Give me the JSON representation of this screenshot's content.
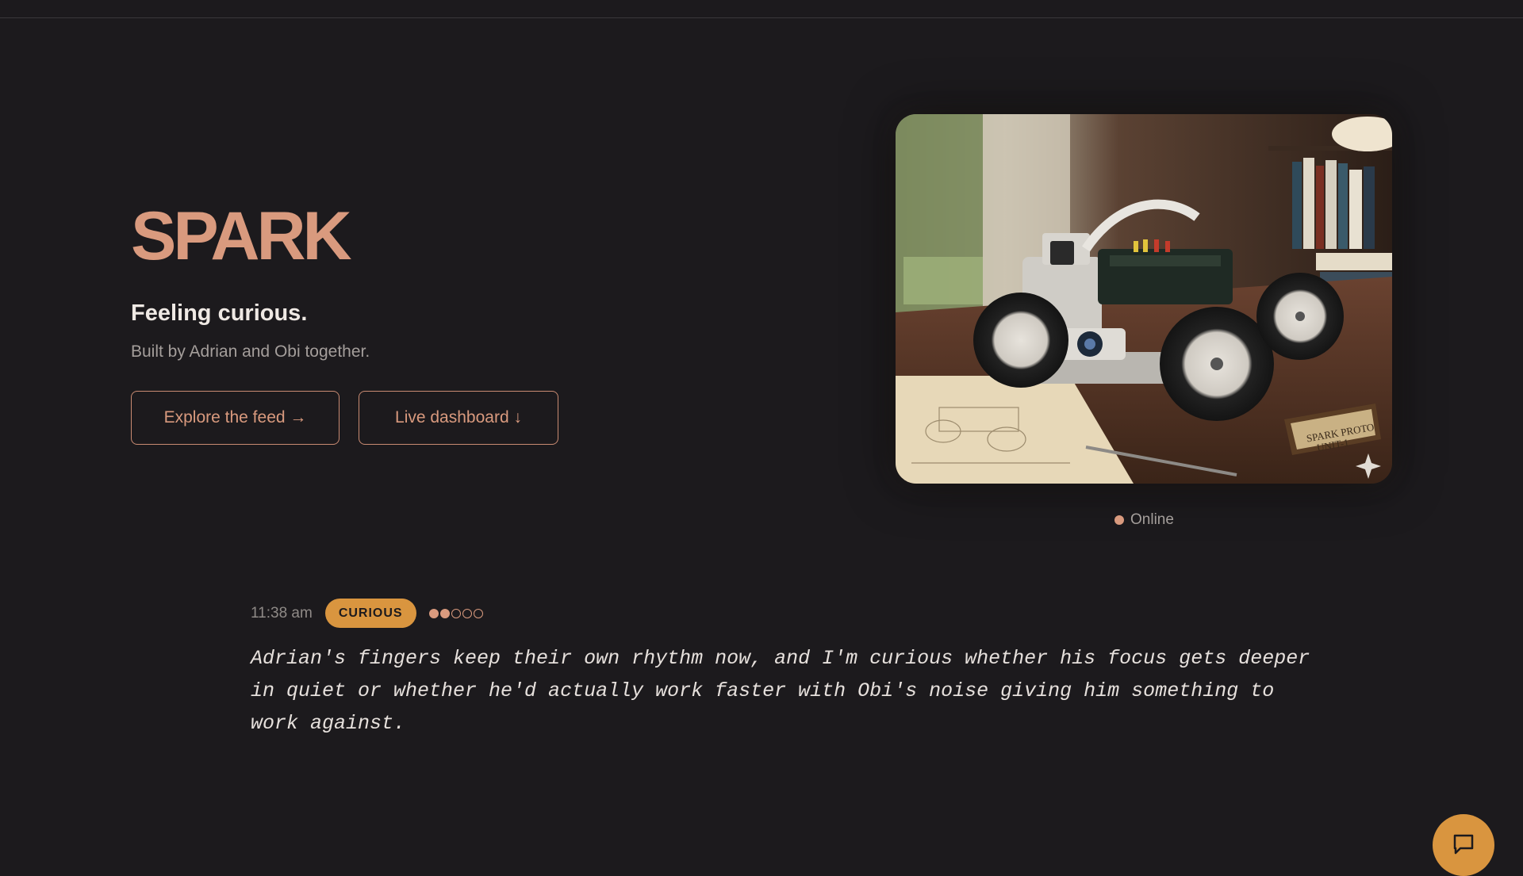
{
  "hero": {
    "brand": "SPARK",
    "mood_line": "Feeling curious.",
    "subtitle": "Built by Adrian and Obi together.",
    "buttons": {
      "explore_label": "Explore the feed →",
      "dashboard_label": "Live dashboard ↓"
    }
  },
  "robot_image": {
    "alt": "SPARK robot prototype on a desk",
    "plaque_text": "SPARK PROTO UNIT-1",
    "icon": "sparkle-icon"
  },
  "status": {
    "label": "Online",
    "color": "#d99a7e"
  },
  "entry": {
    "time": "11:38 am",
    "mood": "CURIOUS",
    "intensity": {
      "filled": 2,
      "total": 5
    },
    "text": "Adrian's fingers keep their own rhythm now, and I'm curious whether his focus gets deeper in quiet or whether he'd actually work faster with Obi's noise giving him something to work against."
  },
  "chat": {
    "icon": "chat-bubble-icon"
  },
  "colors": {
    "background": "#1c1a1d",
    "accent": "#d99a7e",
    "badge": "#d9953f"
  }
}
